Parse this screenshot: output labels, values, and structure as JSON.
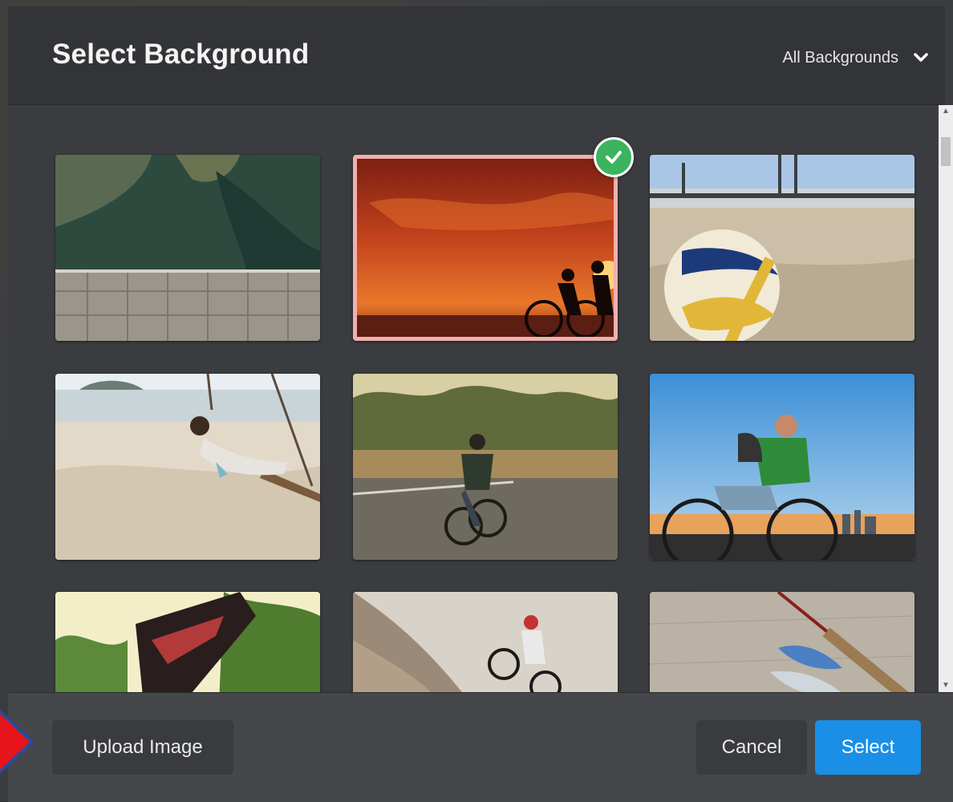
{
  "dialog": {
    "title": "Select Background",
    "filter_label": "All Backgrounds",
    "filter_icon": "chevron-down-icon"
  },
  "thumbnails": [
    {
      "name": "thumb-aerial-coast",
      "selected": false
    },
    {
      "name": "thumb-sunset-cyclists",
      "selected": true
    },
    {
      "name": "thumb-volleyball-beach",
      "selected": false
    },
    {
      "name": "thumb-beach-swing",
      "selected": false
    },
    {
      "name": "thumb-road-cyclist",
      "selected": false
    },
    {
      "name": "thumb-city-cyclist",
      "selected": false
    },
    {
      "name": "thumb-forest-cyclist",
      "selected": false
    },
    {
      "name": "thumb-rock-bmx",
      "selected": false
    },
    {
      "name": "thumb-fishing-rod",
      "selected": false
    }
  ],
  "footer": {
    "upload_label": "Upload Image",
    "cancel_label": "Cancel",
    "select_label": "Select"
  },
  "colors": {
    "accent": "#1a8fe6",
    "check": "#3bb35f",
    "annotation_arrow": "#e8141b"
  }
}
